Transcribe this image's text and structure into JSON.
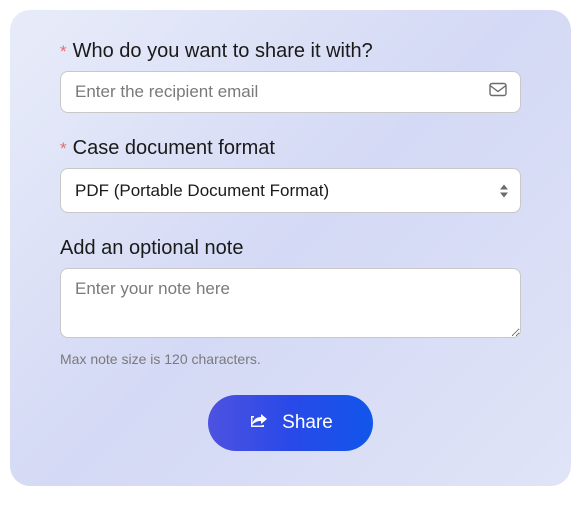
{
  "form": {
    "recipient": {
      "label": "Who do you want to share it with?",
      "placeholder": "Enter the recipient email",
      "required_marker": "*"
    },
    "format": {
      "label": "Case document format",
      "required_marker": "*",
      "selected": "PDF (Portable Document Format)"
    },
    "note": {
      "label": "Add an optional note",
      "placeholder": "Enter your note here",
      "helper": "Max note size is 120 characters."
    },
    "submit": {
      "label": "Share"
    }
  }
}
